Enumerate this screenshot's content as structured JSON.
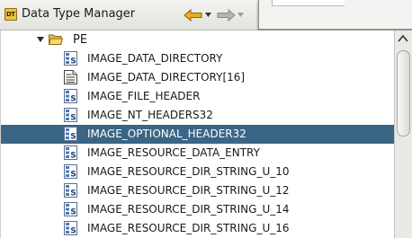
{
  "window": {
    "title": "Data Type Manager",
    "title_icon_text": "DT"
  },
  "toolbar": {
    "back_icon": "back-arrow-icon",
    "forward_icon": "forward-arrow-icon"
  },
  "tree": {
    "folder": {
      "label": "PE",
      "expanded": true,
      "icon": "folder-open-icon"
    },
    "items": [
      {
        "label": "IMAGE_DATA_DIRECTORY",
        "icon": "structure-icon",
        "selected": false
      },
      {
        "label": "IMAGE_DATA_DIRECTORY[16]",
        "icon": "array-icon",
        "selected": false
      },
      {
        "label": "IMAGE_FILE_HEADER",
        "icon": "structure-icon",
        "selected": false
      },
      {
        "label": "IMAGE_NT_HEADERS32",
        "icon": "structure-icon",
        "selected": false
      },
      {
        "label": "IMAGE_OPTIONAL_HEADER32",
        "icon": "structure-icon",
        "selected": true
      },
      {
        "label": "IMAGE_RESOURCE_DATA_ENTRY",
        "icon": "structure-icon",
        "selected": false
      },
      {
        "label": "IMAGE_RESOURCE_DIR_STRING_U_10",
        "icon": "structure-icon",
        "selected": false
      },
      {
        "label": "IMAGE_RESOURCE_DIR_STRING_U_12",
        "icon": "structure-icon",
        "selected": false
      },
      {
        "label": "IMAGE_RESOURCE_DIR_STRING_U_14",
        "icon": "structure-icon",
        "selected": false
      },
      {
        "label": "IMAGE_RESOURCE_DIR_STRING_U_16",
        "icon": "structure-icon",
        "selected": false
      }
    ]
  },
  "colors": {
    "selection": "#3b6584",
    "selected_text": "#ffffff",
    "back_arrow": "#e8b020",
    "forward_arrow": "#9a9a9a"
  }
}
